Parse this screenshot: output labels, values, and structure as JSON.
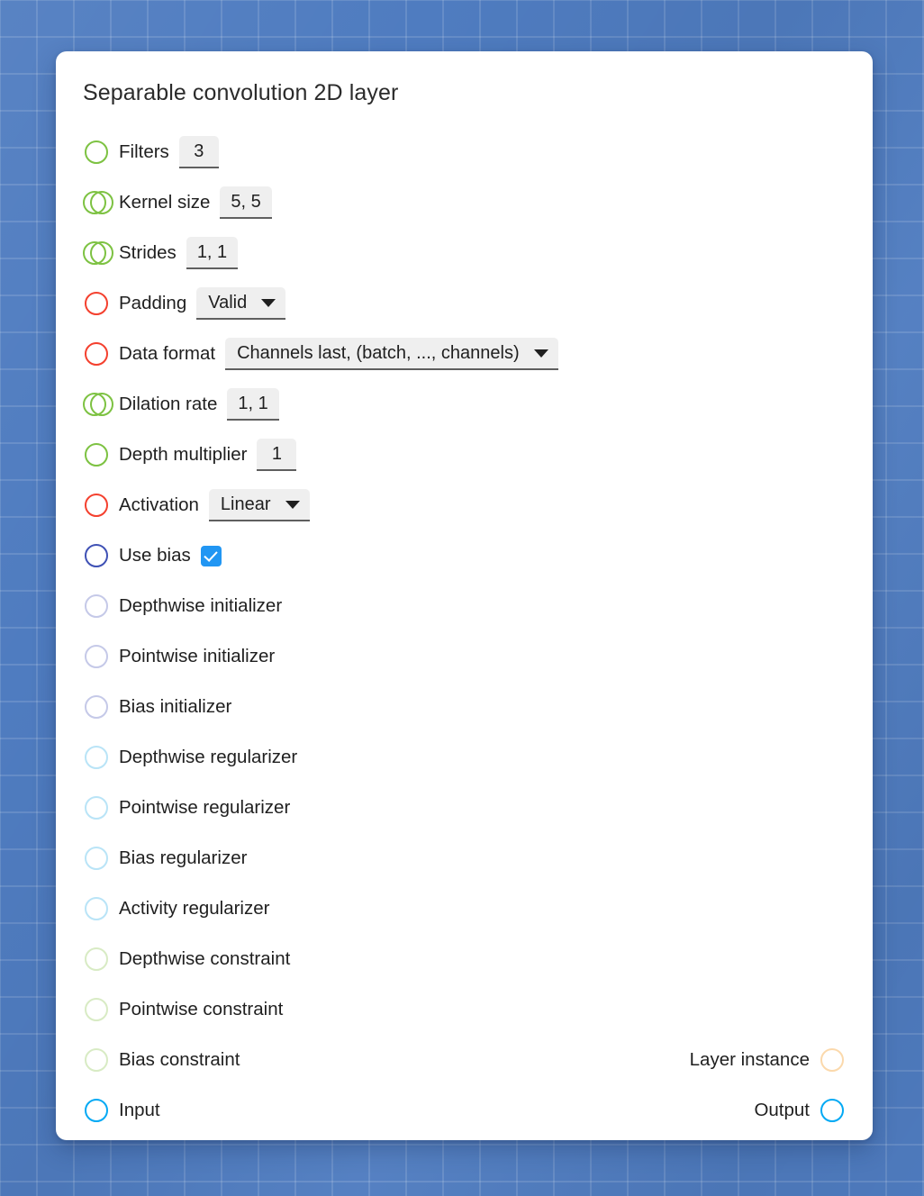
{
  "card": {
    "title": "Separable convolution 2D layer"
  },
  "colors": {
    "background": "#4f7cc0",
    "grid_line": "#6a93cc",
    "card": "#ffffff",
    "port_green": "#7dc242",
    "port_red": "#f4402e",
    "port_indigo": "#3f51b5",
    "port_lavender_pale": "#c5c9e8",
    "port_cyan_pale": "#b9e4f7",
    "port_green_pale": "#d8ebc4",
    "port_orange_pale": "#fbd9ac",
    "port_blue_bright": "#03a9f4",
    "checkbox_blue": "#2196f3",
    "field_bg": "#efefef",
    "field_underline": "#5f5f5f",
    "text": "#1f1f1f"
  },
  "rows": [
    {
      "label": "Filters",
      "port": {
        "style": "single",
        "color": "#7dc242"
      },
      "control": {
        "kind": "text",
        "value": "3"
      }
    },
    {
      "label": "Kernel size",
      "port": {
        "style": "double",
        "color": "#7dc242"
      },
      "control": {
        "kind": "text",
        "value": "5, 5"
      }
    },
    {
      "label": "Strides",
      "port": {
        "style": "double",
        "color": "#7dc242"
      },
      "control": {
        "kind": "text",
        "value": "1, 1"
      }
    },
    {
      "label": "Padding",
      "port": {
        "style": "single",
        "color": "#f4402e"
      },
      "control": {
        "kind": "select",
        "value": "Valid"
      }
    },
    {
      "label": "Data format",
      "port": {
        "style": "single",
        "color": "#f4402e"
      },
      "control": {
        "kind": "select",
        "value": "Channels last, (batch, ..., channels)"
      }
    },
    {
      "label": "Dilation rate",
      "port": {
        "style": "double",
        "color": "#7dc242"
      },
      "control": {
        "kind": "text",
        "value": "1, 1"
      }
    },
    {
      "label": "Depth multiplier",
      "port": {
        "style": "single",
        "color": "#7dc242"
      },
      "control": {
        "kind": "text",
        "value": "1"
      }
    },
    {
      "label": "Activation",
      "port": {
        "style": "single",
        "color": "#f4402e"
      },
      "control": {
        "kind": "select",
        "value": "Linear"
      }
    },
    {
      "label": "Use bias",
      "port": {
        "style": "single",
        "color": "#3f51b5"
      },
      "control": {
        "kind": "checkbox",
        "checked": true
      }
    },
    {
      "label": "Depthwise initializer",
      "port": {
        "style": "single",
        "color": "#c5c9e8"
      },
      "control": {
        "kind": "none"
      }
    },
    {
      "label": "Pointwise initializer",
      "port": {
        "style": "single",
        "color": "#c5c9e8"
      },
      "control": {
        "kind": "none"
      }
    },
    {
      "label": "Bias initializer",
      "port": {
        "style": "single",
        "color": "#c5c9e8"
      },
      "control": {
        "kind": "none"
      }
    },
    {
      "label": "Depthwise regularizer",
      "port": {
        "style": "single",
        "color": "#b9e4f7"
      },
      "control": {
        "kind": "none"
      }
    },
    {
      "label": "Pointwise regularizer",
      "port": {
        "style": "single",
        "color": "#b9e4f7"
      },
      "control": {
        "kind": "none"
      }
    },
    {
      "label": "Bias regularizer",
      "port": {
        "style": "single",
        "color": "#b9e4f7"
      },
      "control": {
        "kind": "none"
      }
    },
    {
      "label": "Activity regularizer",
      "port": {
        "style": "single",
        "color": "#b9e4f7"
      },
      "control": {
        "kind": "none"
      }
    },
    {
      "label": "Depthwise constraint",
      "port": {
        "style": "single",
        "color": "#d8ebc4"
      },
      "control": {
        "kind": "none"
      }
    },
    {
      "label": "Pointwise constraint",
      "port": {
        "style": "single",
        "color": "#d8ebc4"
      },
      "control": {
        "kind": "none"
      }
    },
    {
      "label": "Bias constraint",
      "port": {
        "style": "single",
        "color": "#d8ebc4"
      },
      "control": {
        "kind": "none"
      },
      "right": {
        "label": "Layer instance",
        "port": {
          "style": "single",
          "color": "#fbd9ac"
        }
      }
    },
    {
      "label": "Input",
      "port": {
        "style": "single",
        "color": "#03a9f4"
      },
      "control": {
        "kind": "none"
      },
      "right": {
        "label": "Output",
        "port": {
          "style": "single",
          "color": "#03a9f4"
        }
      }
    }
  ]
}
